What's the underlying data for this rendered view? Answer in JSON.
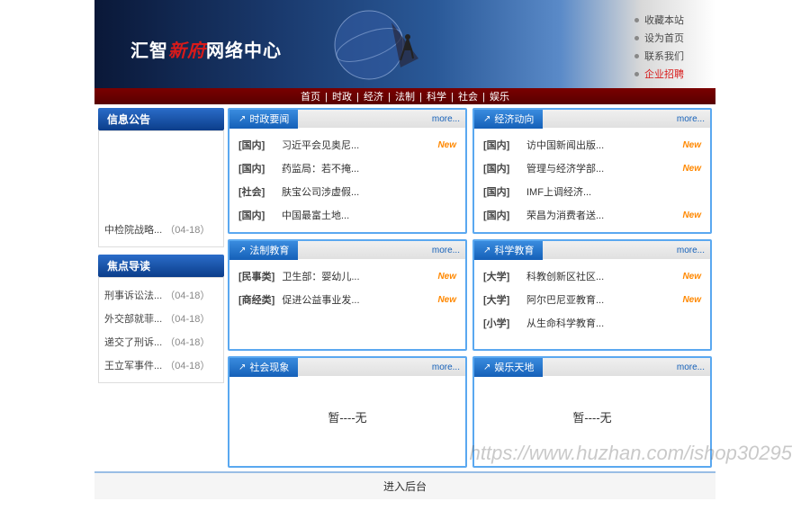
{
  "banner": {
    "title_part1": "汇智",
    "title_red": "新府",
    "title_part2": "网络中心"
  },
  "quick_links": [
    {
      "label": "收藏本站",
      "highlight": false
    },
    {
      "label": "设为首页",
      "highlight": false
    },
    {
      "label": "联系我们",
      "highlight": false
    },
    {
      "label": "企业招聘",
      "highlight": true
    }
  ],
  "nav": [
    {
      "label": "首页"
    },
    {
      "label": "时政"
    },
    {
      "label": "经济"
    },
    {
      "label": "法制"
    },
    {
      "label": "科学"
    },
    {
      "label": "社会"
    },
    {
      "label": "娱乐"
    }
  ],
  "sidebar": {
    "announce": {
      "header": "信息公告",
      "items": [
        {
          "text": "中检院战略...",
          "date": "（04-18）"
        }
      ]
    },
    "focus": {
      "header": "焦点导读",
      "items": [
        {
          "text": "刑事诉讼法...",
          "date": "（04-18）"
        },
        {
          "text": "外交部就菲...",
          "date": "（04-18）"
        },
        {
          "text": "递交了刑诉...",
          "date": "（04-18）"
        },
        {
          "text": "王立军事件...",
          "date": "（04-18）"
        }
      ]
    }
  },
  "more_label": "more...",
  "new_label": "New",
  "empty_label": "暂----无",
  "panels": [
    {
      "title": "时政要闻",
      "items": [
        {
          "tag": "[国内]",
          "text": "习近平会见奥尼...",
          "is_new": true
        },
        {
          "tag": "[国内]",
          "text": "药监局：若不掩...",
          "is_new": false
        },
        {
          "tag": "[社会]",
          "text": "肤宝公司涉虚假...",
          "is_new": false
        },
        {
          "tag": "[国内]",
          "text": "中国最富土地...",
          "is_new": false
        }
      ]
    },
    {
      "title": "经济动向",
      "items": [
        {
          "tag": "[国内]",
          "text": "访中国新闻出版...",
          "is_new": true
        },
        {
          "tag": "[国内]",
          "text": "管理与经济学部...",
          "is_new": true
        },
        {
          "tag": "[国内]",
          "text": "IMF上调经济...",
          "is_new": false
        },
        {
          "tag": "[国内]",
          "text": "荣昌为消费者送...",
          "is_new": true
        }
      ]
    },
    {
      "title": "法制教育",
      "items": [
        {
          "tag": "[民事类]",
          "text": "卫生部：婴幼儿...",
          "is_new": true
        },
        {
          "tag": "[商经类]",
          "text": "促进公益事业发...",
          "is_new": true
        }
      ]
    },
    {
      "title": "科学教育",
      "items": [
        {
          "tag": "[大学]",
          "text": "科教创新区社区...",
          "is_new": true
        },
        {
          "tag": "[大学]",
          "text": "阿尔巴尼亚教育...",
          "is_new": true
        },
        {
          "tag": "[小学]",
          "text": "从生命科学教育...",
          "is_new": false
        }
      ]
    },
    {
      "title": "社会现象",
      "empty": true
    },
    {
      "title": "娱乐天地",
      "empty": true
    }
  ],
  "footer": {
    "admin_label": "进入后台"
  },
  "watermark": "https://www.huzhan.com/ishop30295"
}
